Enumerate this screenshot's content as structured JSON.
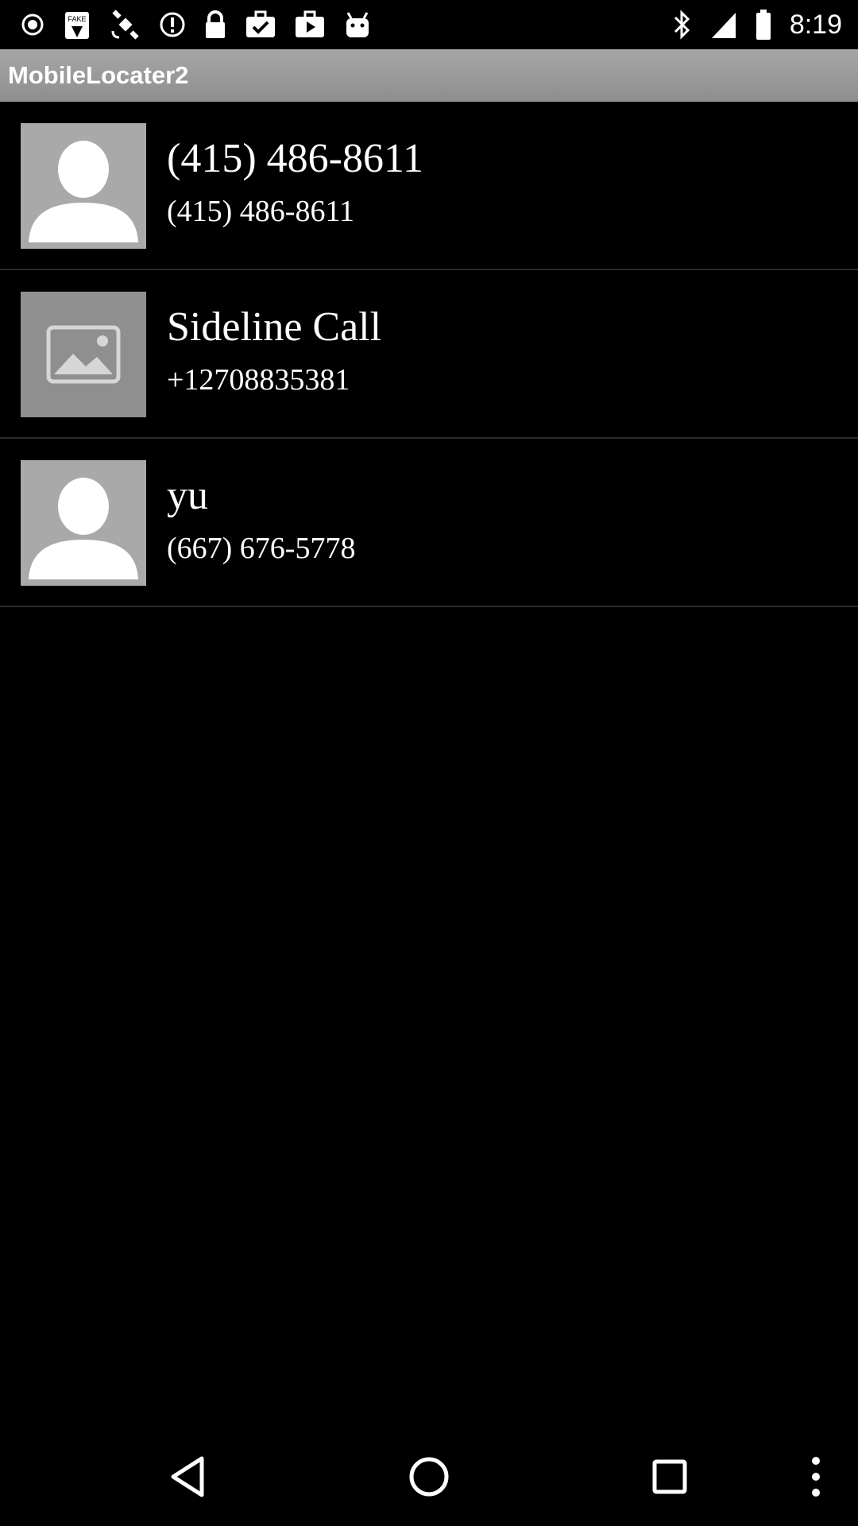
{
  "status_bar": {
    "time": "8:19",
    "left_icons": [
      "record-icon",
      "fake-gps-icon",
      "satellite-icon",
      "alert-icon",
      "lock-icon",
      "task-icon",
      "play-store-icon",
      "android-icon"
    ],
    "right_icons": [
      "bluetooth-icon",
      "signal-icon",
      "battery-icon"
    ]
  },
  "app": {
    "title": "MobileLocater2"
  },
  "contacts": [
    {
      "name": "(415) 486-8611",
      "number": "(415) 486-8611",
      "avatar": "person-silhouette-icon"
    },
    {
      "name": "Sideline Call",
      "number": "+12708835381",
      "avatar": "image-placeholder-icon"
    },
    {
      "name": "yu",
      "number": "(667) 676-5778",
      "avatar": "person-silhouette-icon"
    }
  ],
  "nav_bar": {
    "buttons": [
      "back-icon",
      "home-icon",
      "recents-icon",
      "overflow-menu-icon"
    ]
  },
  "colors": {
    "background": "#000000",
    "title_bar": "#9a9a9a",
    "text": "#ffffff",
    "divider": "#2b2b2b",
    "avatar": "#a9a9a9"
  }
}
